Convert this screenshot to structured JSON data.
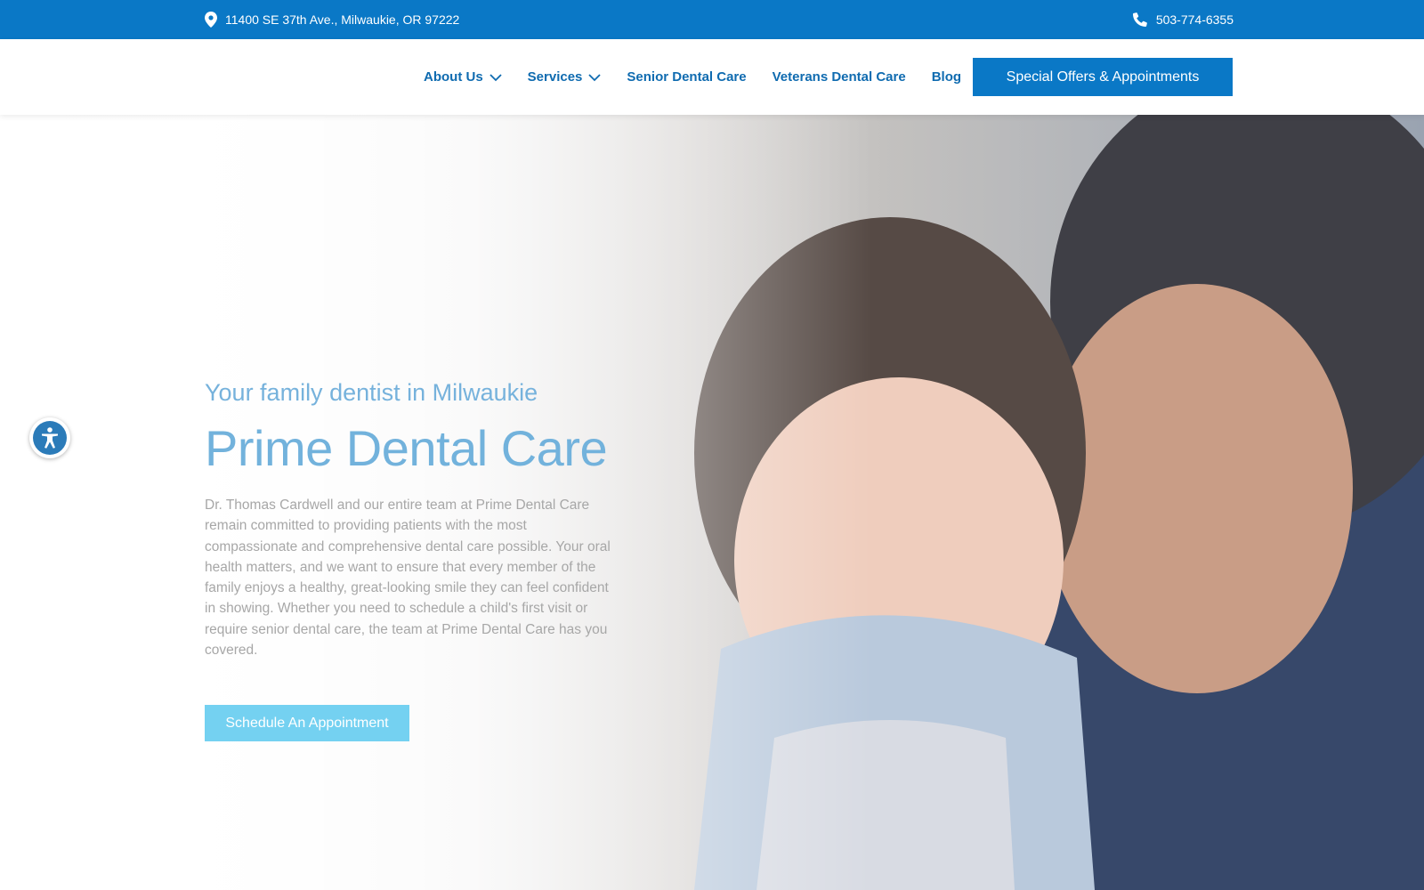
{
  "topbar": {
    "address": "11400 SE 37th Ave., Milwaukie, OR 97222",
    "phone": "503-774-6355"
  },
  "nav": {
    "items": [
      {
        "label": "About Us",
        "has_dropdown": true
      },
      {
        "label": "Services",
        "has_dropdown": true
      },
      {
        "label": "Senior Dental Care",
        "has_dropdown": false
      },
      {
        "label": "Veterans Dental Care",
        "has_dropdown": false
      },
      {
        "label": "Blog",
        "has_dropdown": false
      }
    ],
    "cta_label": "Special Offers & Appointments"
  },
  "hero": {
    "eyebrow": "Your family dentist in Milwaukie",
    "title": "Prime Dental Care",
    "description": "Dr. Thomas Cardwell and our entire team at Prime Dental Care remain committed to providing patients with the most compassionate and comprehensive dental care possible. Your oral health matters, and we want to ensure that every member of the family enjoys a healthy, great-looking smile they can feel confident in showing. Whether you need to schedule a child's first visit or require senior dental care, the team at Prime Dental Care has you covered.",
    "button_label": "Schedule An Appointment"
  },
  "icons": {
    "address": "map-pin-icon",
    "phone": "phone-icon",
    "dropdown": "chevron-down-icon",
    "accessibility": "accessibility-icon"
  },
  "colors": {
    "brand_blue": "#0a78c6",
    "nav_text": "#0f6bb0",
    "hero_heading": "#72b2dc",
    "hero_button": "#74d1f1"
  }
}
